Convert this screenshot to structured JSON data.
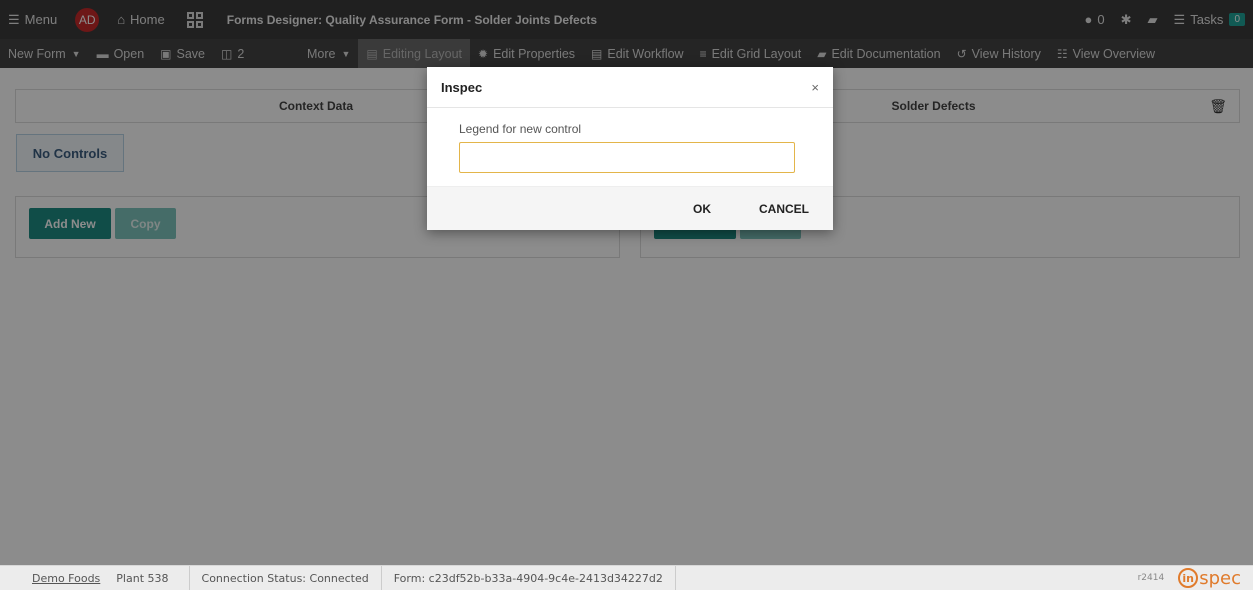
{
  "topbar": {
    "menu_label": "Menu",
    "menu_icon": "hamburger-icon",
    "avatar_initials": "AD",
    "home_label": "Home",
    "home_icon": "home-icon",
    "qr_icon": "qr-code-icon",
    "title": "Forms Designer: Quality Assurance Form - Solder Joints Defects",
    "comments_count": "0",
    "tasks_label": "Tasks",
    "tasks_count": "0"
  },
  "toolbar": {
    "new_form": "New Form",
    "open": "Open",
    "save": "Save",
    "columns": "2",
    "more": "More",
    "editing_layout": "Editing Layout",
    "edit_properties": "Edit Properties",
    "edit_workflow": "Edit Workflow",
    "edit_grid_layout": "Edit Grid Layout",
    "edit_documentation": "Edit Documentation",
    "view_history": "View History",
    "view_overview": "View Overview"
  },
  "main": {
    "tab_context": "Context Data",
    "tab_solder": "Solder Defects",
    "no_controls": "No Controls",
    "add_new": "Add New",
    "copy": "Copy"
  },
  "modal": {
    "title": "Inspec",
    "close": "×",
    "legend_label": "Legend for new control",
    "legend_value": "",
    "ok": "OK",
    "cancel": "CANCEL"
  },
  "statusbar": {
    "company": "Demo Foods",
    "plant": "Plant 538",
    "connection": "Connection Status: Connected",
    "form_id": "Form: c23df52b-b33a-4904-9c4e-2413d34227d2",
    "revision": "r2414",
    "logo_text": "spec"
  },
  "colors": {
    "topbar": "#3b3b3b",
    "accent": "#1e8c83",
    "avatar": "#c62a2a",
    "logo": "#e07b2c"
  }
}
